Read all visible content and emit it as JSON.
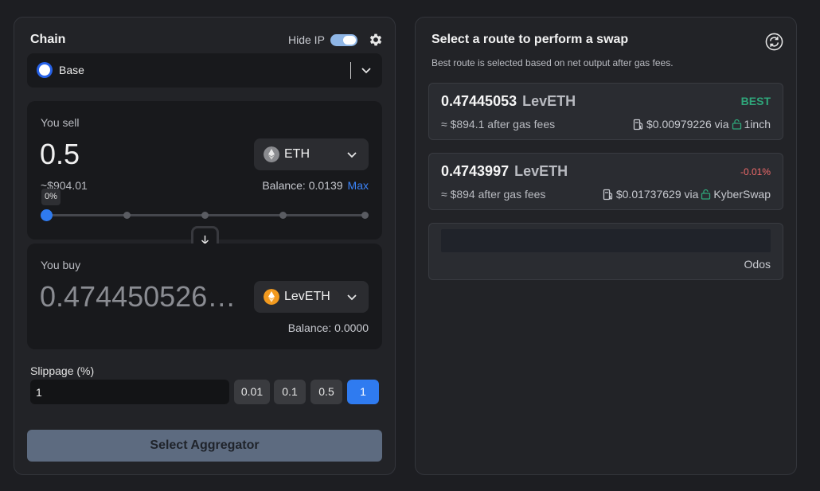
{
  "left": {
    "chain_title": "Chain",
    "hide_ip_label": "Hide IP",
    "hide_ip_on": true,
    "chain": {
      "name": "Base",
      "color": "#2762e8"
    },
    "sell": {
      "label": "You sell",
      "amount": "0.5",
      "token": "ETH",
      "usd": "~$904.01",
      "balance": "Balance: 0.0139",
      "max": "Max",
      "percent": "0%",
      "percent_value": 0
    },
    "buy": {
      "label": "You buy",
      "amount": "0.474450526…",
      "token": "LevETH",
      "balance": "Balance: 0.0000"
    },
    "slippage": {
      "label": "Slippage (%)",
      "value": "1",
      "options": [
        "0.01",
        "0.1",
        "0.5",
        "1"
      ],
      "selected": "1"
    },
    "action_button": "Select Aggregator"
  },
  "right": {
    "title": "Select a route to perform a swap",
    "subtitle": "Best route is selected based on net output after gas fees.",
    "routes": [
      {
        "amount": "0.47445053",
        "token": "LevETH",
        "badge": "BEST",
        "after": "≈ $894.1 after gas fees",
        "gas": "$0.00979226 via",
        "aggregator": "1inch"
      },
      {
        "amount": "0.4743997",
        "token": "LevETH",
        "badge": "-0.01%",
        "after": "≈ $894 after gas fees",
        "gas": "$0.01737629 via",
        "aggregator": "KyberSwap"
      },
      {
        "aggregator": "Odos",
        "loading": true
      }
    ]
  },
  "colors": {
    "accent": "#2f7bf0",
    "best": "#2fa67a",
    "negative": "#f06a6a"
  }
}
